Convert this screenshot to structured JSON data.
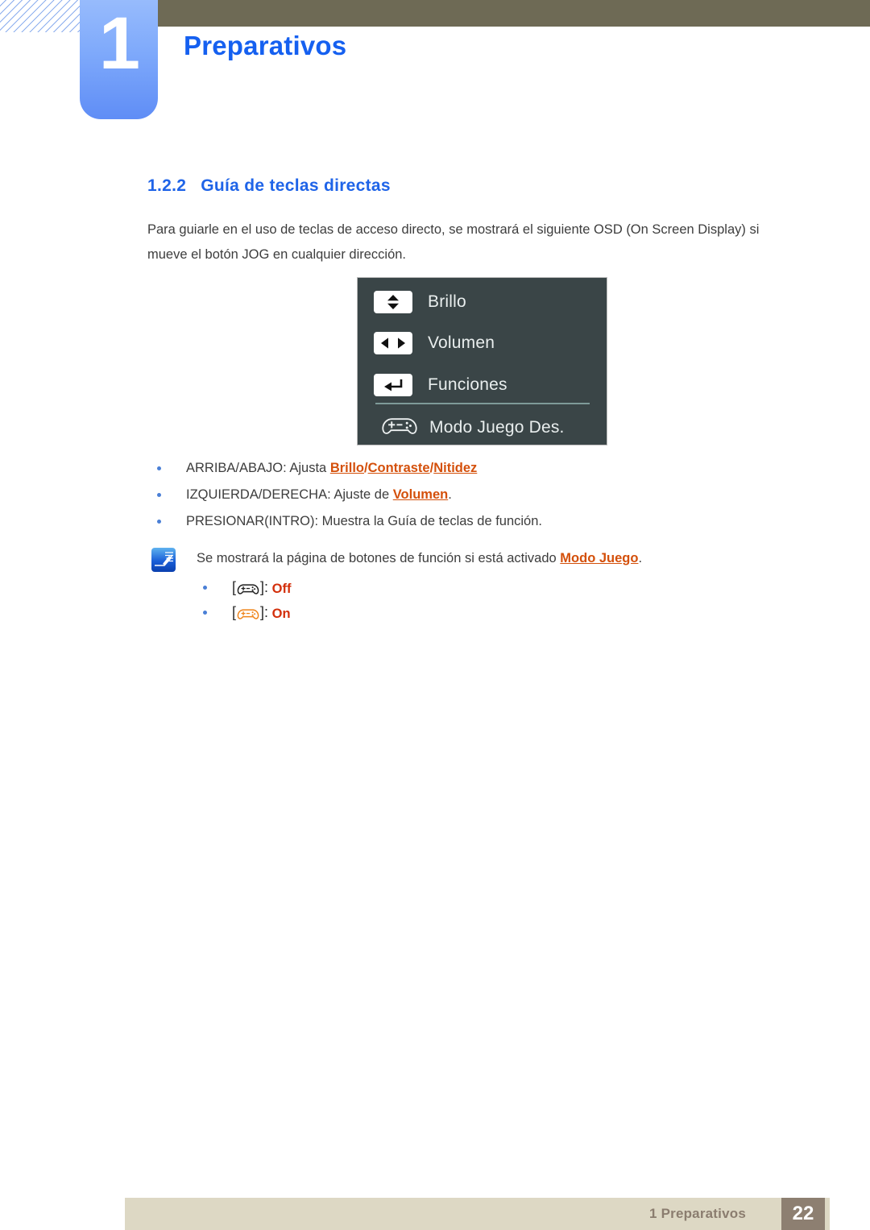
{
  "header": {
    "chapter_number": "1",
    "chapter_title": "Preparativos"
  },
  "section": {
    "number": "1.2.2",
    "title": "Guía de teclas directas"
  },
  "intro_paragraph": "Para guiarle en el uso de teclas de acceso directo, se mostrará el siguiente OSD (On Screen Display) si mueve el botón JOG en cualquier dirección.",
  "osd": {
    "rows": [
      {
        "key_icon": "up-down-arrows-icon",
        "label": "Brillo"
      },
      {
        "key_icon": "left-right-arrows-icon",
        "label": "Volumen"
      },
      {
        "key_icon": "enter-return-icon",
        "label": "Funciones"
      },
      {
        "key_icon": "gamepad-icon",
        "label": "Modo Juego Des."
      }
    ]
  },
  "bullets": [
    {
      "prefix": "ARRIBA/ABAJO: Ajusta ",
      "terms": [
        "Brillo",
        "Contraste",
        "Nitidez"
      ],
      "separator": "/",
      "suffix": ""
    },
    {
      "prefix": "IZQUIERDA/DERECHA: Ajuste de ",
      "terms": [
        "Volumen"
      ],
      "separator": "",
      "suffix": "."
    },
    {
      "prefix": "PRESIONAR(INTRO): Muestra la Guía de teclas de función.",
      "terms": [],
      "separator": "",
      "suffix": ""
    }
  ],
  "note": {
    "icon": "note-pen-icon",
    "text_prefix": "Se mostrará la página de botones de función si está activado ",
    "text_term": "Modo Juego",
    "text_suffix": ".",
    "items": [
      {
        "icon": "gamepad-icon-black",
        "bracket_open": "[",
        "bracket_close": "]:",
        "state": "Off"
      },
      {
        "icon": "gamepad-icon-orange",
        "bracket_open": "[",
        "bracket_close": "]:",
        "state": "On"
      }
    ]
  },
  "footer": {
    "label": "1 Preparativos",
    "page_number": "22"
  },
  "colors": {
    "accent_blue": "#1560f0",
    "heading_blue": "#1f64e8",
    "highlight_orange": "#d4500b",
    "state_red": "#d32f0b",
    "osd_background": "#3a4547",
    "header_olive": "#6e6a55",
    "footer_beige": "#ddd8c4",
    "footer_page_brown": "#8d7f71"
  }
}
